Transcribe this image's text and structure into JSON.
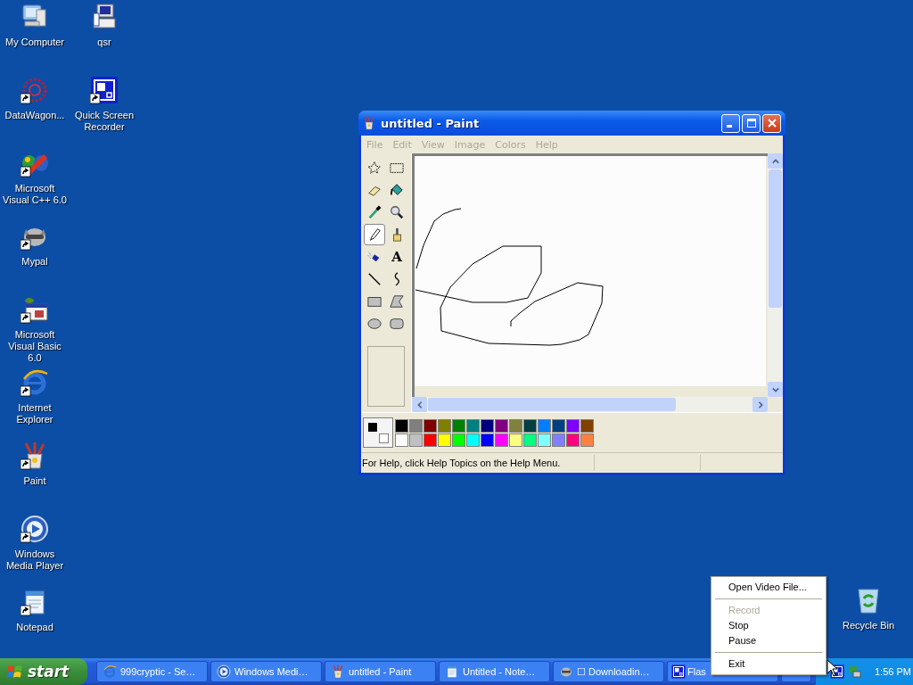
{
  "desktop_icons": [
    {
      "label": "My Computer",
      "kind": "computer",
      "shortcut": false
    },
    {
      "label": "DataWagon...",
      "kind": "web",
      "shortcut": true
    },
    {
      "label": "Microsoft Visual C++ 6.0",
      "kind": "vcpp",
      "shortcut": true
    },
    {
      "label": "Mypal",
      "kind": "raccoon",
      "shortcut": true
    },
    {
      "label": "Microsoft Visual Basic 6.0",
      "kind": "vb",
      "shortcut": true
    },
    {
      "label": "Internet Explorer",
      "kind": "ie",
      "shortcut": true
    },
    {
      "label": "Paint",
      "kind": "paint",
      "shortcut": true
    },
    {
      "label": "Windows Media Player",
      "kind": "wmp",
      "shortcut": true
    },
    {
      "label": "Notepad",
      "kind": "notepad",
      "shortcut": true
    },
    {
      "label": "qsr",
      "kind": "printer",
      "shortcut": false
    },
    {
      "label": "Quick Screen Recorder",
      "kind": "recorder",
      "shortcut": true
    }
  ],
  "recycle_bin": {
    "label": "Recycle Bin"
  },
  "paint_window": {
    "title": "untitled - Paint",
    "menu": [
      {
        "label": "File",
        "disabled": true
      },
      {
        "label": "Edit",
        "disabled": true
      },
      {
        "label": "View",
        "disabled": true
      },
      {
        "label": "Image",
        "disabled": true
      },
      {
        "label": "Colors",
        "disabled": true
      },
      {
        "label": "Help",
        "disabled": true
      }
    ],
    "tools": [
      {
        "kind": "lasso",
        "selected": false
      },
      {
        "kind": "select",
        "selected": false
      },
      {
        "kind": "eraser",
        "selected": false
      },
      {
        "kind": "fill",
        "selected": false
      },
      {
        "kind": "picker",
        "selected": false
      },
      {
        "kind": "magnifier",
        "selected": false
      },
      {
        "kind": "pencil",
        "selected": true
      },
      {
        "kind": "brush",
        "selected": false
      },
      {
        "kind": "airbrush",
        "selected": false
      },
      {
        "kind": "text",
        "label": "A",
        "selected": false
      },
      {
        "kind": "line",
        "selected": false
      },
      {
        "kind": "curve",
        "selected": false
      },
      {
        "kind": "rectangle",
        "selected": false
      },
      {
        "kind": "polygon",
        "selected": false
      },
      {
        "kind": "ellipse",
        "selected": false
      },
      {
        "kind": "roundrect",
        "selected": false
      }
    ],
    "palette": {
      "current": [
        {
          "color": "#000000"
        },
        {
          "color": "#ffffff"
        }
      ],
      "colors": [
        {
          "color": "#000000"
        },
        {
          "color": "#808080"
        },
        {
          "color": "#800000"
        },
        {
          "color": "#808000"
        },
        {
          "color": "#008000"
        },
        {
          "color": "#008080"
        },
        {
          "color": "#000080"
        },
        {
          "color": "#800080"
        },
        {
          "color": "#808040"
        },
        {
          "color": "#004040"
        },
        {
          "color": "#0080ff"
        },
        {
          "color": "#004080"
        },
        {
          "color": "#8000ff"
        },
        {
          "color": "#804000"
        },
        {
          "color": "#ffffff"
        },
        {
          "color": "#c0c0c0"
        },
        {
          "color": "#ff0000"
        },
        {
          "color": "#ffff00"
        },
        {
          "color": "#00ff00"
        },
        {
          "color": "#00ffff"
        },
        {
          "color": "#0000ff"
        },
        {
          "color": "#ff00ff"
        },
        {
          "color": "#ffff80"
        },
        {
          "color": "#00ff80"
        },
        {
          "color": "#80ffff"
        },
        {
          "color": "#8080ff"
        },
        {
          "color": "#ff0080"
        },
        {
          "color": "#ff8040"
        }
      ]
    },
    "status": "For Help, click Help Topics on the Help Menu."
  },
  "context_menu": [
    {
      "kind": "item",
      "label": "Open Video File...",
      "disabled": false
    },
    {
      "kind": "separator"
    },
    {
      "kind": "item",
      "label": "Record",
      "disabled": true
    },
    {
      "kind": "item",
      "label": "Stop",
      "disabled": false
    },
    {
      "kind": "item",
      "label": "Pause",
      "disabled": false
    },
    {
      "kind": "separator"
    },
    {
      "kind": "item",
      "label": "Exit",
      "disabled": false
    }
  ],
  "taskbar": {
    "start": "start",
    "tasks": [
      {
        "label": "999cryptic - Se…",
        "kind": "ie",
        "selected": false
      },
      {
        "label": "Windows Medi…",
        "kind": "wmp",
        "selected": false
      },
      {
        "label": "untitled - Paint",
        "kind": "paint",
        "selected": false
      },
      {
        "label": "Untitled - Note…",
        "kind": "notepad",
        "selected": false
      },
      {
        "label": "☐ Downloadin…",
        "kind": "raccoon",
        "selected": false
      },
      {
        "label": "Flas",
        "kind": "recorder",
        "selected": false
      }
    ],
    "clock": "1:56 PM"
  }
}
